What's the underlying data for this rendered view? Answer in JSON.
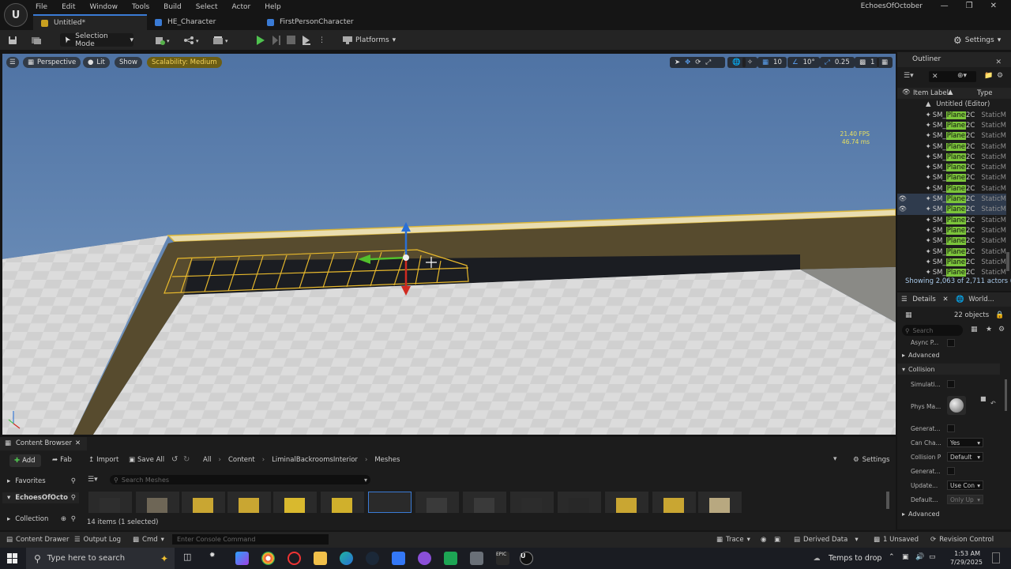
{
  "app": {
    "menu": [
      "File",
      "Edit",
      "Window",
      "Tools",
      "Build",
      "Select",
      "Actor",
      "Help"
    ],
    "project_name": "EchoesOfOctober",
    "tabs": [
      {
        "label": "Untitled*",
        "active": true
      },
      {
        "label": "HE_Character",
        "active": false
      },
      {
        "label": "FirstPersonCharacter",
        "active": false
      }
    ]
  },
  "toolbar": {
    "mode_label": "Selection Mode",
    "platforms_label": "Platforms",
    "settings_label": "Settings"
  },
  "viewport": {
    "perspective_label": "Perspective",
    "lit_label": "Lit",
    "show_label": "Show",
    "scalability_label": "Scalability: Medium",
    "fps_line1": "21.40 FPS",
    "fps_line2": "46.74 ms",
    "grid_snap": "10",
    "rot_snap": "10°",
    "scale_snap": "0.25",
    "camera_speed": "1"
  },
  "outliner": {
    "title": "Outliner",
    "col_label": "Item Label",
    "col_type": "Type",
    "root_label": "Untitled (Editor)",
    "row_prefix": "SM_",
    "row_highlight": "Plane",
    "row_suffix": "2C",
    "row_type": "StaticM",
    "rows": [
      {
        "selected": false
      },
      {
        "selected": false
      },
      {
        "selected": false
      },
      {
        "selected": false
      },
      {
        "selected": false
      },
      {
        "selected": false
      },
      {
        "selected": false
      },
      {
        "selected": false
      },
      {
        "selected": true
      },
      {
        "selected": true
      },
      {
        "selected": false
      },
      {
        "selected": false
      },
      {
        "selected": false
      },
      {
        "selected": false
      },
      {
        "selected": false
      },
      {
        "selected": false
      }
    ],
    "status": "Showing 2,063 of 2,711 actors (2"
  },
  "details": {
    "tab_details": "Details",
    "tab_world": "World...",
    "objects_count": "22 objects",
    "search_placeholder": "Search",
    "async_label": "Async P...",
    "advanced_label": "Advanced",
    "collision_label": "Collision",
    "simulate_label": "Simulati...",
    "phys_label": "Phys Ma...",
    "generate1_label": "Generat...",
    "can_label": "Can Cha...",
    "can_value": "Yes",
    "collision_preset_label": "Collision P",
    "collision_preset_value": "Default",
    "generate2_label": "Generat...",
    "update_label": "Update...",
    "update_value": "Use Con",
    "default_label": "Default...",
    "default_value": "Only Up",
    "advanced2_label": "Advanced"
  },
  "content_browser": {
    "title": "Content Browser",
    "add_label": "Add",
    "fab_label": "Fab",
    "import_label": "Import",
    "save_all_label": "Save All",
    "breadcrumbs": [
      "All",
      "Content",
      "LiminalBackroomsInterior",
      "Meshes"
    ],
    "settings_label": "Settings",
    "favorites_label": "Favorites",
    "project_label": "EchoesOfOcto",
    "collection_label": "Collection",
    "search_placeholder": "Search Meshes",
    "items_status": "14 items (1 selected)",
    "thumb_colors": [
      "#2e2e2e",
      "#6e6656",
      "#c9a632",
      "#c9a632",
      "#d9b92e",
      "#d0b02c",
      "#2a2a2a",
      "#3a3a3a",
      "#3a3a3a",
      "#2c2c2c",
      "#282828",
      "#c9a632",
      "#c9a632",
      "#b8a880"
    ]
  },
  "statusbar": {
    "content_drawer": "Content Drawer",
    "output_log": "Output Log",
    "cmd": "Cmd",
    "console_placeholder": "Enter Console Command",
    "trace": "Trace",
    "derived_data": "Derived Data",
    "unsaved": "1 Unsaved",
    "revision_control": "Revision Control"
  },
  "taskbar": {
    "search_placeholder": "Type here to search",
    "weather": "Temps to drop",
    "time": "1:53 AM",
    "date": "7/29/2025"
  }
}
